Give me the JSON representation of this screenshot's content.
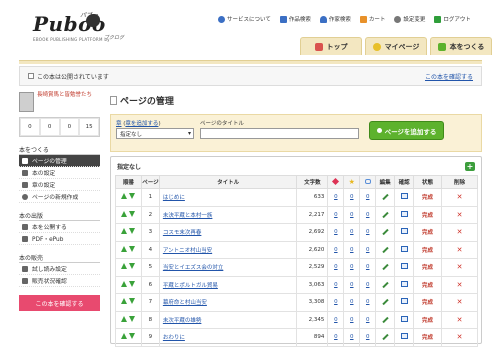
{
  "logo": {
    "name": "Puboo",
    "kana": "パブー",
    "subtitle": "EBOOK PUBLISHING PLATFORM by",
    "byline": "ブクログ"
  },
  "toplinks": [
    {
      "label": "サービスについて",
      "icon": "globe-icon",
      "color": "#3b6fc4"
    },
    {
      "label": "作品検索",
      "icon": "book-icon",
      "color": "#3b6fc4"
    },
    {
      "label": "作家検索",
      "icon": "person-icon",
      "color": "#3b6fc4"
    },
    {
      "label": "カート",
      "icon": "cart-icon",
      "color": "#e8912a"
    },
    {
      "label": "設定変更",
      "icon": "gear-icon",
      "color": "#777777"
    },
    {
      "label": "ログアウト",
      "icon": "logout-icon",
      "color": "#2f9e3a"
    }
  ],
  "nav": [
    {
      "label": "トップ",
      "icon": "home-icon",
      "color": "#d9534f"
    },
    {
      "label": "マイページ",
      "icon": "smile-icon",
      "color": "#e8c02a"
    },
    {
      "label": "本をつくる",
      "icon": "plus-icon",
      "color": "#5db22d"
    }
  ],
  "notice": {
    "text": "この本は公開されています",
    "link": "この本を確認する"
  },
  "sidebar": {
    "book_title": "長崎賞馬と皆勉誉たち",
    "stats": [
      "0",
      "0",
      "0",
      "15"
    ],
    "sections": [
      {
        "heading": "本をつくる",
        "items": [
          {
            "label": "ページの管理",
            "active": true
          },
          {
            "label": "本の設定",
            "active": false
          },
          {
            "label": "章の設定",
            "active": false
          },
          {
            "label": "ページの新規作成",
            "active": false
          }
        ]
      },
      {
        "heading": "本の出版",
        "items": [
          {
            "label": "本を公開する",
            "active": false
          },
          {
            "label": "PDF・ePub",
            "active": false
          }
        ]
      },
      {
        "heading": "本の販売",
        "items": [
          {
            "label": "試し読み設定",
            "active": false
          },
          {
            "label": "販売状況確認",
            "active": false
          }
        ]
      }
    ],
    "red_button": "この本を確認する"
  },
  "main": {
    "title": "ページの管理",
    "form": {
      "chapter_label": "章",
      "chapter_link": "章を追加する",
      "chapter_select": "指定なし",
      "page_title_label": "ページのタイトル",
      "page_title_value": "",
      "add_button": "ページを追加する"
    },
    "table_caption": "指定なし",
    "columns": [
      "順番",
      "ページ",
      "タイトル",
      "文字数",
      "",
      "",
      "",
      "編集",
      "確認",
      "状態",
      "削除"
    ],
    "rows": [
      {
        "page": "1",
        "title": "はじめに",
        "chars": "633",
        "c1": "0",
        "c2": "0",
        "c3": "0",
        "status": "完成"
      },
      {
        "page": "2",
        "title": "未決平蔵と本村一族",
        "chars": "2,217",
        "c1": "0",
        "c2": "0",
        "c3": "0",
        "status": "完成"
      },
      {
        "page": "3",
        "title": "コスモ末次再春",
        "chars": "2,692",
        "c1": "0",
        "c2": "0",
        "c3": "0",
        "status": "完成"
      },
      {
        "page": "4",
        "title": "アントニオ村山当安",
        "chars": "2,620",
        "c1": "0",
        "c2": "0",
        "c3": "0",
        "status": "完成"
      },
      {
        "page": "5",
        "title": "当安とイエズス会の対立",
        "chars": "2,529",
        "c1": "0",
        "c2": "0",
        "c3": "0",
        "status": "完成"
      },
      {
        "page": "6",
        "title": "平蔵とポルトガル貿易",
        "chars": "3,063",
        "c1": "0",
        "c2": "0",
        "c3": "0",
        "status": "完成"
      },
      {
        "page": "7",
        "title": "幕府命と村山当安",
        "chars": "3,308",
        "c1": "0",
        "c2": "0",
        "c3": "0",
        "status": "完成"
      },
      {
        "page": "8",
        "title": "未次平蔵の雄勢",
        "chars": "2,345",
        "c1": "0",
        "c2": "0",
        "c3": "0",
        "status": "完成"
      },
      {
        "page": "9",
        "title": "おわりに",
        "chars": "894",
        "c1": "0",
        "c2": "0",
        "c3": "0",
        "status": "完成"
      }
    ]
  }
}
